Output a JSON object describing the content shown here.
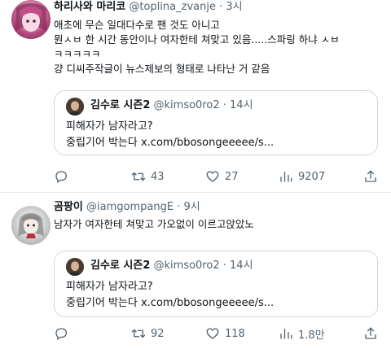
{
  "tweets": [
    {
      "author": {
        "name": "하리사와 마리코",
        "handle": "@toplina_zvanje",
        "time": "3시"
      },
      "lines": [
        "애초에 무슨 일대다수로 팬 것도 아니고",
        "뭔ㅅㅂ 한 시간 동안이나 여자한테 쳐맞고 있음.....스파링 하냐 ㅅㅂ",
        "ㅋㅋㅋㅋㅋ",
        "걍 디씨주작글이 뉴스제보의 형태로 나타난 거 같음"
      ],
      "quote": {
        "name": "김수로 시즌2",
        "handle": "@kimso0ro2",
        "time": "14시",
        "lines": [
          "피해자가 남자라고?",
          "중립기어 박는다 x.com/bbosongeeeee/s..."
        ]
      },
      "actions": {
        "reply": "",
        "retweet": "43",
        "like": "27",
        "views": "9207"
      }
    },
    {
      "author": {
        "name": "곰팡이",
        "handle": "@iamgompangE",
        "time": "9시"
      },
      "lines": [
        "남자가 여자한테 쳐맞고 가오없이 이르고앉았노"
      ],
      "quote": {
        "name": "김수로 시즌2",
        "handle": "@kimso0ro2",
        "time": "14시",
        "lines": [
          "피해자가 남자라고?",
          "중립기어 박는다 x.com/bbosongeeeee/s..."
        ]
      },
      "actions": {
        "reply": "",
        "retweet": "92",
        "like": "118",
        "views": "1.8만"
      }
    }
  ],
  "icons": {
    "reply": "reply-icon",
    "retweet": "retweet-icon",
    "like": "like-icon",
    "views": "views-icon",
    "share": "share-icon"
  },
  "colors": {
    "text": "#0f1419",
    "muted": "#536471",
    "border": "#cfd9de"
  }
}
